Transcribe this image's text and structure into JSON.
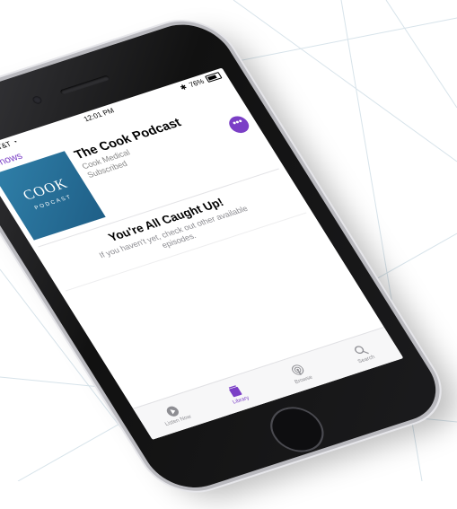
{
  "status_bar": {
    "carrier": "AT&T",
    "time": "12:01 PM",
    "battery": "76%"
  },
  "nav": {
    "back_label": "Shows"
  },
  "podcast": {
    "title": "The Cook Podcast",
    "author": "Cook Medical",
    "status": "Subscribed",
    "artwork_title": "COOK",
    "artwork_subtitle": "PODCAST"
  },
  "more_button_label": "•••",
  "empty_state": {
    "title": "You're All Caught Up!",
    "message": "If you haven't yet, check out other available episodes."
  },
  "tabs": [
    {
      "label": "Listen Now",
      "icon": "play-circle-icon",
      "active": false
    },
    {
      "label": "Library",
      "icon": "library-icon",
      "active": true
    },
    {
      "label": "Browse",
      "icon": "podcast-icon",
      "active": false
    },
    {
      "label": "Search",
      "icon": "search-icon",
      "active": false
    }
  ],
  "colors": {
    "accent": "#7b3fc6",
    "artwork": "#2f7fa8"
  }
}
